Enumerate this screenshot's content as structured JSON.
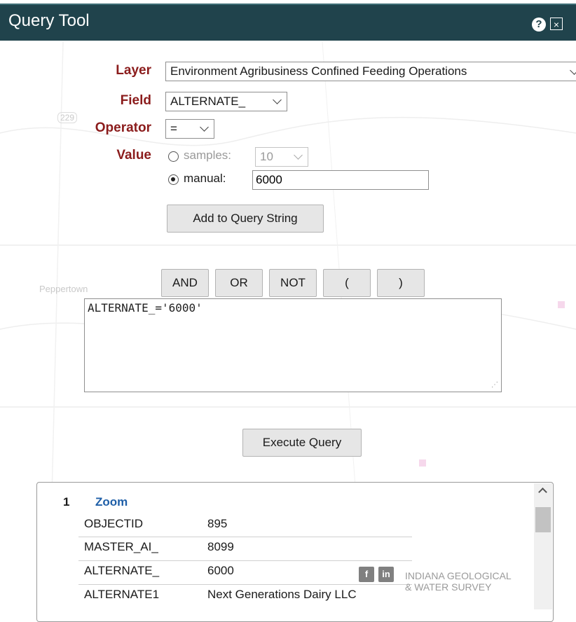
{
  "window": {
    "title": "Query Tool",
    "help_icon": "?",
    "close_icon": "×"
  },
  "map": {
    "place_label": "Peppertown",
    "road_marker": "229"
  },
  "form": {
    "layer": {
      "label": "Layer",
      "value": "Environment Agribusiness Confined Feeding Operations"
    },
    "field": {
      "label": "Field",
      "value": "ALTERNATE_"
    },
    "operator": {
      "label": "Operator",
      "value": "="
    },
    "value": {
      "label": "Value",
      "samples_label": "samples:",
      "samples_value": "10",
      "manual_label": "manual:",
      "manual_value": "6000",
      "selected": "manual"
    },
    "add_button": "Add to Query String"
  },
  "operators": [
    "AND",
    "OR",
    "NOT",
    "(",
    ")"
  ],
  "query_string": "ALTERNATE_='6000'",
  "execute_button": "Execute Query",
  "results": {
    "index": "1",
    "zoom_label": "Zoom",
    "rows": [
      {
        "key": "OBJECTID",
        "value": "895"
      },
      {
        "key": "MASTER_AI_",
        "value": "8099"
      },
      {
        "key": "ALTERNATE_",
        "value": "6000"
      },
      {
        "key": "ALTERNATE1",
        "value": "Next Generations Dairy LLC"
      }
    ]
  },
  "watermark": {
    "line1": "INDIANA GEOLOGICAL",
    "line2": "& WATER SURVEY"
  },
  "colors": {
    "titlebar": "#20434c",
    "label": "#8b1c1c",
    "link": "#1f5fa8"
  }
}
